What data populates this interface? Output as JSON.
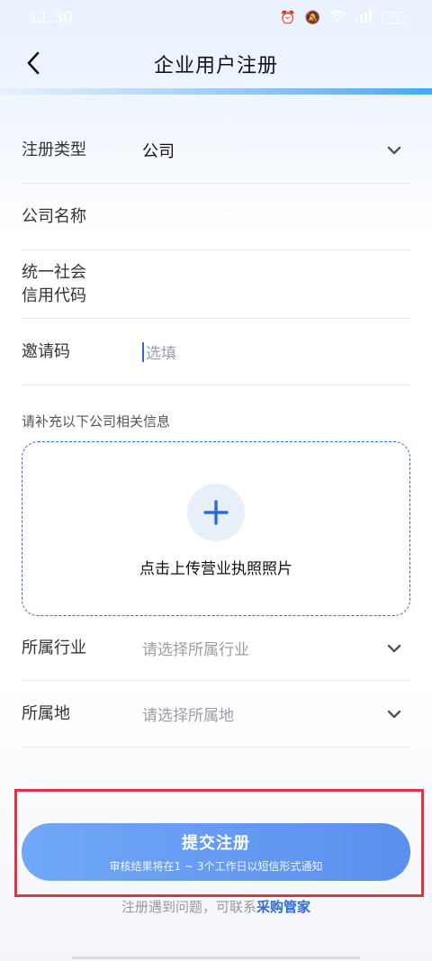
{
  "status_bar": {
    "time": "11:30",
    "battery": "30"
  },
  "header": {
    "title": "企业用户注册"
  },
  "form": {
    "register_type": {
      "label": "注册类型",
      "value": "公司"
    },
    "company_name": {
      "label": "公司名称",
      "value": ""
    },
    "credit_code": {
      "label_line1": "统一社会",
      "label_line2": "信用代码",
      "value": ""
    },
    "invite_code": {
      "label": "邀请码",
      "placeholder": "选填"
    }
  },
  "supplement_hint": "请补充以下公司相关信息",
  "upload": {
    "label": "点击上传营业执照照片"
  },
  "form2": {
    "industry": {
      "label": "所属行业",
      "placeholder": "请选择所属行业"
    },
    "location": {
      "label": "所属地",
      "placeholder": "请选择所属地"
    }
  },
  "submit": {
    "label": "提交注册",
    "note": "审核结果将在1 ~ 3个工作日以短信形式通知"
  },
  "contact": {
    "text": "注册遇到问题，可联系",
    "link": "采购管家"
  },
  "colors": {
    "accent": "#2f6bd8",
    "button": "#5b8ff0",
    "highlight": "#e03348"
  }
}
